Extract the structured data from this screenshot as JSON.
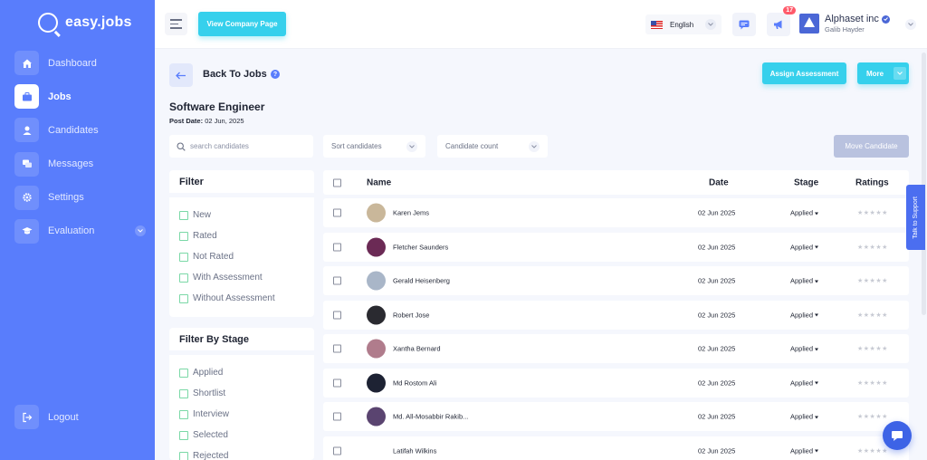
{
  "brand": {
    "name": "easy.jobs"
  },
  "sidebar": {
    "items": [
      {
        "label": "Dashboard",
        "icon": "home-icon"
      },
      {
        "label": "Jobs",
        "icon": "briefcase-icon",
        "active": true
      },
      {
        "label": "Candidates",
        "icon": "user-icon"
      },
      {
        "label": "Messages",
        "icon": "chat-icon"
      },
      {
        "label": "Settings",
        "icon": "gear-icon"
      },
      {
        "label": "Evaluation",
        "icon": "graduation-cap-icon"
      }
    ],
    "logout_label": "Logout"
  },
  "topbar": {
    "view_company_label": "View Company Page",
    "language": "English",
    "notification_count": "17",
    "company_name": "Alphaset inc",
    "user_name": "Galib Hayder"
  },
  "job": {
    "back_label": "Back To Jobs",
    "help_glyph": "?",
    "title": "Software Engineer",
    "post_date_label": "Post Date:",
    "post_date": "02 Jun, 2025"
  },
  "actions": {
    "assign_label": "Assign Assessment",
    "more_label": "More",
    "move_label": "Move Candidate"
  },
  "toolbar": {
    "search_placeholder": "search candidates",
    "sort_label": "Sort candidates",
    "count_label": "Candidate count"
  },
  "filter": {
    "title": "Filter",
    "options": [
      "New",
      "Rated",
      "Not Rated",
      "With Assessment",
      "Without Assessment"
    ]
  },
  "stage_filter": {
    "title": "Filter By Stage",
    "options": [
      "Applied",
      "Shortlist",
      "Interview",
      "Selected",
      "Rejected"
    ]
  },
  "table": {
    "headers": {
      "name": "Name",
      "date": "Date",
      "stage": "Stage",
      "ratings": "Ratings"
    },
    "rows": [
      {
        "name": "Karen Jems",
        "date": "02 Jun 2025",
        "stage": "Applied",
        "rating": 0,
        "avatar_color": "#c9b79a"
      },
      {
        "name": "Fletcher Saunders",
        "date": "02 Jun 2025",
        "stage": "Applied",
        "rating": 0,
        "avatar_color": "#6b2a55"
      },
      {
        "name": "Gerald Heisenberg",
        "date": "02 Jun 2025",
        "stage": "Applied",
        "rating": 0,
        "avatar_color": "#a9b6c8"
      },
      {
        "name": "Robert Jose",
        "date": "02 Jun 2025",
        "stage": "Applied",
        "rating": 0,
        "avatar_color": "#2a2a30"
      },
      {
        "name": "Xantha Bernard",
        "date": "02 Jun 2025",
        "stage": "Applied",
        "rating": 0,
        "avatar_color": "#b07c8c"
      },
      {
        "name": "Md Rostom Ali",
        "date": "02 Jun 2025",
        "stage": "Applied",
        "rating": 0,
        "avatar_color": "#1d2233"
      },
      {
        "name": "Md. All-Mosabbir Rakib...",
        "date": "02 Jun 2025",
        "stage": "Applied",
        "rating": 0,
        "avatar_color": "#5a4470"
      },
      {
        "name": "Latifah Wilkins",
        "date": "02 Jun 2025",
        "stage": "Applied",
        "rating": 0,
        "avatar_color": ""
      }
    ]
  },
  "support": {
    "label": "Talk to Support"
  },
  "colors": {
    "sidebar": "#597dfc",
    "accent": "#36d0ec",
    "badge": "#ff5a6a"
  }
}
